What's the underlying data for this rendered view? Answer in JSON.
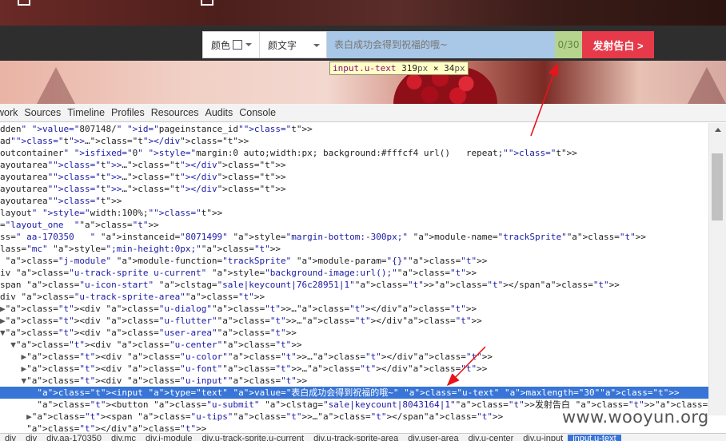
{
  "webpage": {
    "color_label": "颜色",
    "font_select_label": "颜文字",
    "input_placeholder": "表白成功会得到祝福的哦~",
    "counter": "0/30",
    "submit_label": "发射告白 >",
    "inspect_tag": "input.u-text",
    "inspect_width": "319",
    "inspect_height": "34",
    "inspect_unit": "px",
    "inspect_times": "×"
  },
  "devtools": {
    "tabs": [
      "work",
      "Sources",
      "Timeline",
      "Profiles",
      "Resources",
      "Audits",
      "Console"
    ],
    "dom_lines": [
      {
        "indent": "",
        "tri": "",
        "html": "dden\" value=\"807148/\" id=\"pageinstance_id\">"
      },
      {
        "indent": "",
        "tri": "",
        "html": "ad\">…</div>"
      },
      {
        "indent": "",
        "tri": "",
        "html": "outcontainer\" isfixed=\"0\" style=\"margin:0 auto;width:px; background:#fffcf4 url()   repeat;\">"
      },
      {
        "indent": "",
        "tri": "",
        "html": "ayoutarea\">…</div>"
      },
      {
        "indent": "",
        "tri": "",
        "html": "ayoutarea\">…</div>"
      },
      {
        "indent": "",
        "tri": "",
        "html": "ayoutarea\">…</div>"
      },
      {
        "indent": "",
        "tri": "",
        "html": "ayoutarea\">"
      },
      {
        "indent": "",
        "tri": "",
        "html": "layout\" style=\"width:100%;\">"
      },
      {
        "indent": "",
        "tri": "",
        "html": "=\"layout_one  \">"
      },
      {
        "indent": "",
        "tri": "",
        "html": "ss=\" aa-170350   \" instanceid=\"8071499\" style=\"margin-bottom:-300px;\" module-name=\"trackSprite\">"
      },
      {
        "indent": "",
        "tri": "",
        "html": "lass=\"mc\" style=\";min-height:0px;\">"
      },
      {
        "indent": "",
        "tri": "",
        "html": " class=\"j-module\" module-function=\"trackSprite\" module-param=\"{}\">"
      },
      {
        "indent": "",
        "tri": "",
        "html": "iv class=\"u-track-sprite u-current\" style=\"background-image:url();\">"
      },
      {
        "indent": "",
        "tri": "",
        "html": "span class=\"u-icon-start\" clstag=\"sale|keycount|76c28951|1\"></span>"
      },
      {
        "indent": "",
        "tri": "",
        "html": "div class=\"u-track-sprite-area\">"
      },
      {
        "indent": "",
        "tri": "▶",
        "html": "<div class=\"u-dialog\">…</div>"
      },
      {
        "indent": "",
        "tri": "▶",
        "html": "<div class=\"u-flutter\">…</div>"
      },
      {
        "indent": "",
        "tri": "▼",
        "html": "<div class=\"user-area\">"
      },
      {
        "indent": "  ",
        "tri": "▼",
        "html": "<div class=\"u-center\">"
      },
      {
        "indent": "    ",
        "tri": "▶",
        "html": "<div class=\"u-color\">…</div>"
      },
      {
        "indent": "    ",
        "tri": "▶",
        "html": "<div class=\"u-font\">…</div>"
      },
      {
        "indent": "    ",
        "tri": "▼",
        "html": "<div class=\"u-input\">"
      },
      {
        "indent": "       ",
        "tri": "",
        "html": "<input type=\"text\" value=\"表白成功会得到祝福的哦~\" class=\"u-text\" maxlength=\"30\">"
      },
      {
        "indent": "       ",
        "tri": "",
        "html": "<button class=\"u-submit\" clstag=\"sale|keycount|8043164|1\">发射告白 ></button>"
      },
      {
        "indent": "     ",
        "tri": "▶",
        "html": "<span class=\"u-tips\">…</span>"
      },
      {
        "indent": "     ",
        "tri": "",
        "html": "</div>"
      },
      {
        "indent": "",
        "tri": "",
        "html": ""
      }
    ],
    "selected_line": 22,
    "breadcrumbs": [
      "div",
      "div",
      "div.aa-170350",
      "div.mc",
      "div.j-module",
      "div.u-track-sprite.u-current",
      "div.u-track-sprite-area",
      "div.user-area",
      "div.u-center",
      "div.u-input",
      "input.u-text"
    ]
  },
  "watermark": "www.wooyun.org",
  "colors": {
    "submit": "#e63a4a",
    "input_bg": "#a9c7e6",
    "selection": "#3875d7",
    "arrow": "#e8141c"
  }
}
